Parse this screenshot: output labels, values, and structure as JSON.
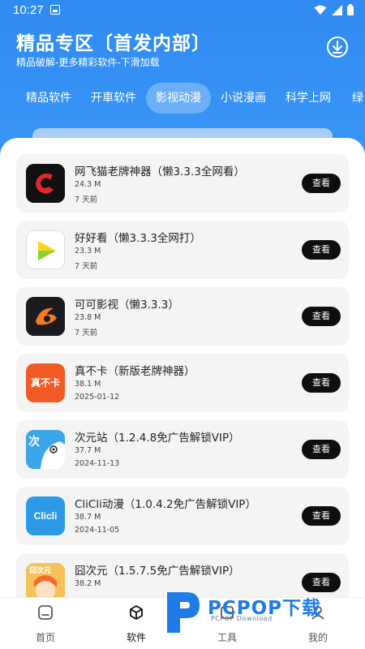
{
  "status_bar": {
    "time": "10:27"
  },
  "header": {
    "title": "精品专区〔首发内部〕",
    "subtitle": "精品破解-更多精彩软件-下滑加载"
  },
  "tabs": [
    "精品软件",
    "开車软件",
    "影视动漫",
    "小说漫画",
    "科学上网",
    "绿"
  ],
  "active_tab": "影视动漫",
  "view_label": "查看",
  "apps": [
    {
      "name": "网飞猫老牌神器（懒3.3.3全网看）",
      "size": "24.3 M",
      "date": "7 天前",
      "icon": "netflix-cat-icon"
    },
    {
      "name": "好好看（懒3.3.3全网打）",
      "size": "23.3 M",
      "date": "7 天前",
      "icon": "play-triangle-icon"
    },
    {
      "name": "可可影视（懒3.3.3）",
      "size": "23.8 M",
      "date": "7 天前",
      "icon": "keke-swirl-icon"
    },
    {
      "name": "真不卡（新版老牌神器）",
      "size": "38.1 M",
      "date": "2025-01-12",
      "icon": "zhenbuka-icon"
    },
    {
      "name": "次元站（1.2.4.8免广告解锁VIP）",
      "size": "37.7 M",
      "date": "2024-11-13",
      "icon": "ciyuan-mascot-icon"
    },
    {
      "name": "CliCli动漫（1.0.4.2免广告解锁VIP）",
      "size": "38.7 M",
      "date": "2024-11-05",
      "icon": "clicli-logo-icon"
    },
    {
      "name": "囧次元（1.5.7.5免广告解锁VIP）",
      "size": "38.2 M",
      "date": "",
      "icon": "jiong-anime-icon"
    }
  ],
  "icon_labels": {
    "zhenbuka": "真不卡",
    "clicli": "Clicli",
    "ciyuan": "次",
    "jiong": "囧次元"
  },
  "bottom_nav": [
    {
      "label": "首页",
      "icon": "home-icon"
    },
    {
      "label": "软件",
      "icon": "cube-icon"
    },
    {
      "label": "工具",
      "icon": "tools-icon"
    },
    {
      "label": "我的",
      "icon": "profile-icon"
    }
  ],
  "active_nav": "软件",
  "watermark": {
    "brand": "PCPOP下载",
    "sub": "PCPOP Download"
  },
  "colors": {
    "accent": "#2f8bf2",
    "button": "#0e0e0e",
    "card": "#f4f4f4"
  }
}
